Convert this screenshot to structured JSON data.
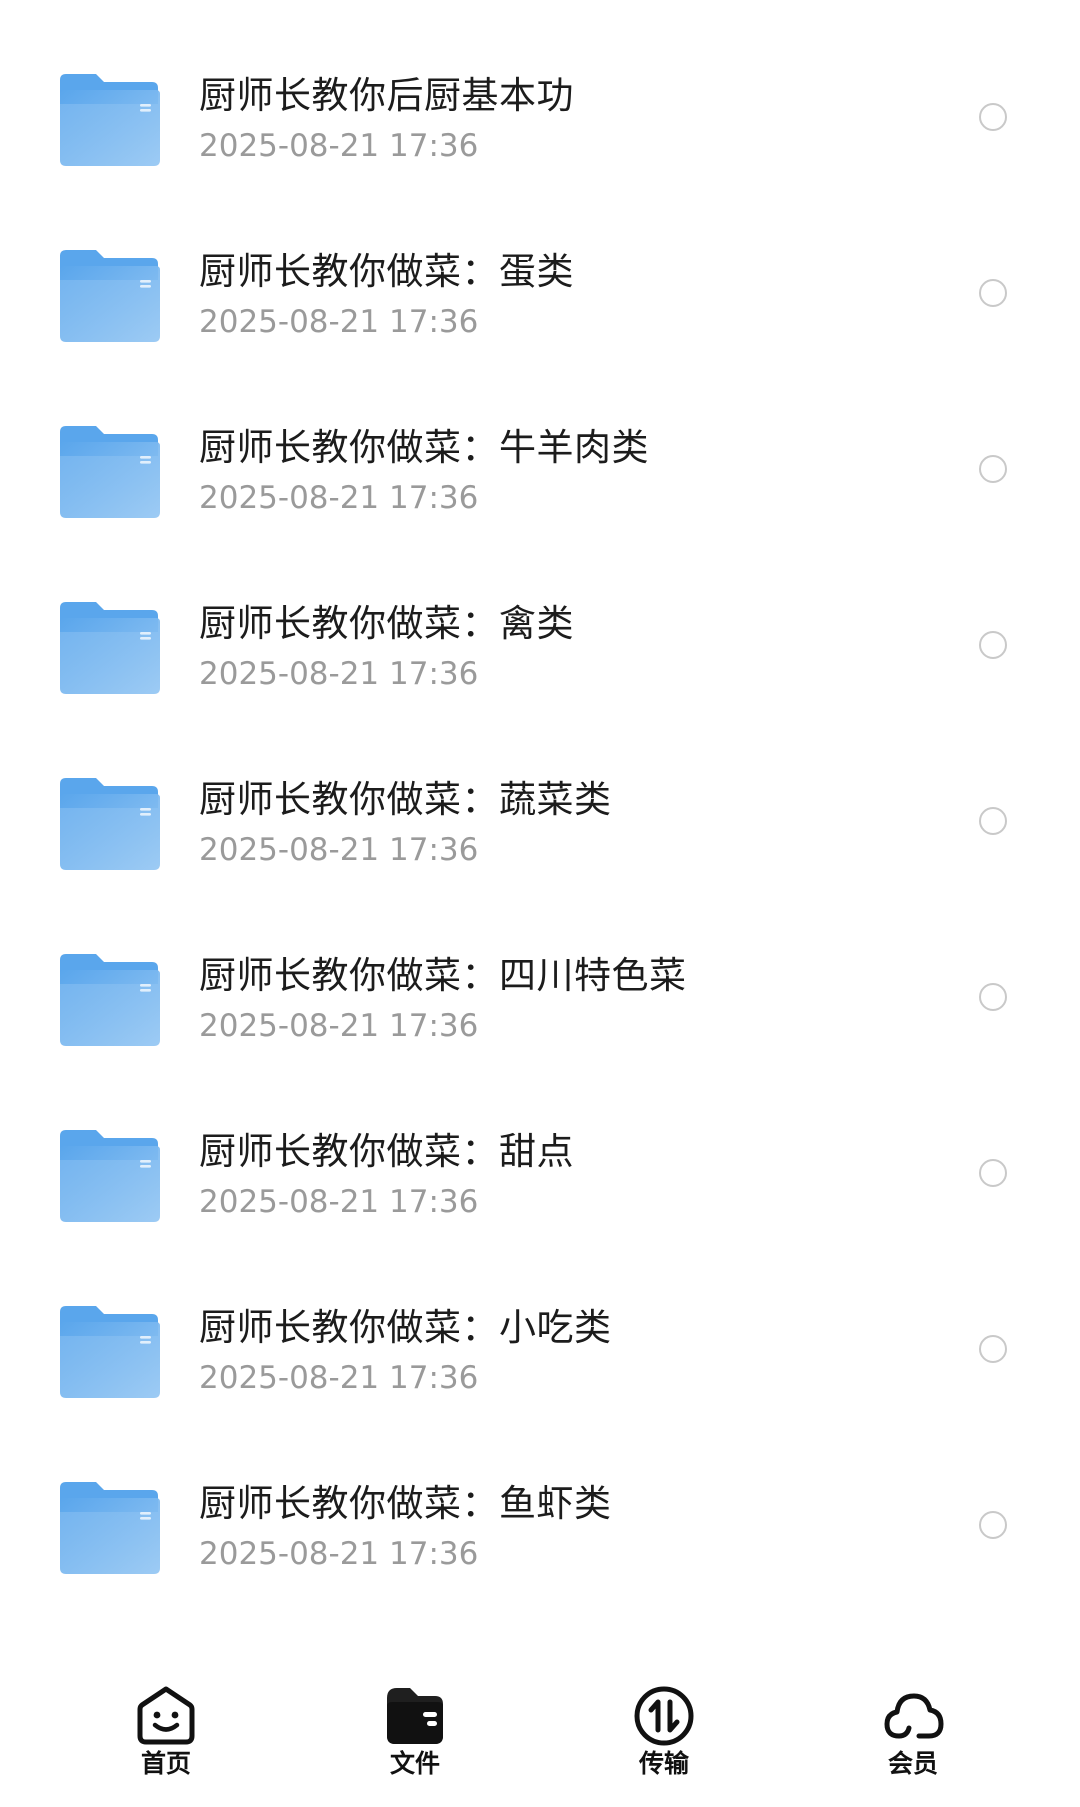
{
  "colors": {
    "folder_front": "#9dcbf4",
    "folder_back": "#5aa6ec",
    "date_text": "#9a9a9a",
    "tab_active": "#1a1a1a"
  },
  "files": [
    {
      "name": "厨师长教你后厨基本功",
      "date": "2025-08-21 17:36",
      "icon": "folder-icon"
    },
    {
      "name": "厨师长教你做菜：蛋类",
      "date": "2025-08-21 17:36",
      "icon": "folder-icon"
    },
    {
      "name": "厨师长教你做菜：牛羊肉类",
      "date": "2025-08-21 17:36",
      "icon": "folder-icon"
    },
    {
      "name": "厨师长教你做菜：禽类",
      "date": "2025-08-21 17:36",
      "icon": "folder-icon"
    },
    {
      "name": "厨师长教你做菜：蔬菜类",
      "date": "2025-08-21 17:36",
      "icon": "folder-icon"
    },
    {
      "name": "厨师长教你做菜：四川特色菜",
      "date": "2025-08-21 17:36",
      "icon": "folder-icon"
    },
    {
      "name": "厨师长教你做菜：甜点",
      "date": "2025-08-21 17:36",
      "icon": "folder-icon"
    },
    {
      "name": "厨师长教你做菜：小吃类",
      "date": "2025-08-21 17:36",
      "icon": "folder-icon"
    },
    {
      "name": "厨师长教你做菜：鱼虾类",
      "date": "2025-08-21 17:36",
      "icon": "folder-icon"
    }
  ],
  "tabbar": {
    "tabs": [
      {
        "label": "首页",
        "icon": "home-face-icon",
        "active": false
      },
      {
        "label": "文件",
        "icon": "wallet-folder-icon",
        "active": true
      },
      {
        "label": "传输",
        "icon": "transfer-arrows-icon",
        "active": false
      },
      {
        "label": "会员",
        "icon": "cloud-icon",
        "active": false
      }
    ]
  }
}
